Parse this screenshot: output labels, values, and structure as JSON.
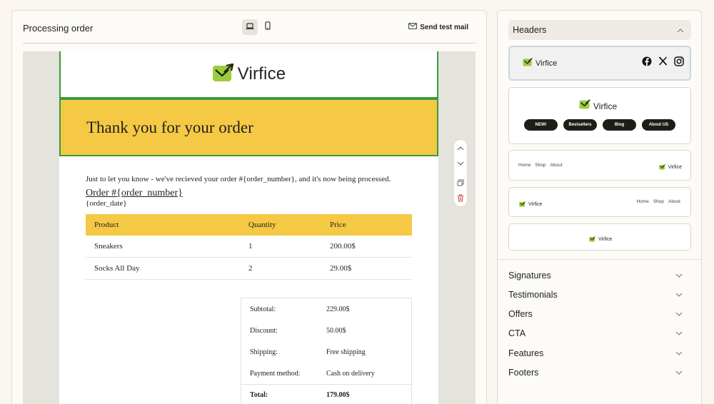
{
  "editor": {
    "title": "Processing order",
    "send_test_label": "Send test mail"
  },
  "email": {
    "brand": "Virfice",
    "hero_title": "Thank you for your order",
    "intro": "Just to let you know - we've recieved your order #{order_number}, and it's now being processed.",
    "order_link": "Order #{order_number}",
    "order_date": "{order_date}",
    "table": {
      "headers": [
        "Product",
        "Quantity",
        "Price"
      ],
      "rows": [
        [
          "Sneakers",
          "1",
          "200.00$"
        ],
        [
          "Socks All Day",
          "2",
          "29.00$"
        ]
      ]
    },
    "totals": [
      {
        "label": "Subtotal:",
        "value": "229.00$"
      },
      {
        "label": "Discount:",
        "value": "50.00$"
      },
      {
        "label": "Shipping:",
        "value": "Free shipping"
      },
      {
        "label": "Payment method:",
        "value": "Cash on delivery"
      },
      {
        "label": "Total:",
        "value": "179.00$"
      }
    ]
  },
  "library": {
    "open_section": "Headers",
    "templates": {
      "brand": "Virfice",
      "pills": [
        "NEW!",
        "Bestsellers",
        "Blog",
        "About US"
      ],
      "nav": [
        "Home",
        "Shop",
        "About"
      ]
    },
    "sections": [
      "Signatures",
      "Testimonials",
      "Offers",
      "CTA",
      "Features",
      "Footers"
    ]
  },
  "colors": {
    "accent_yellow": "#f6c945",
    "selection_green": "#3a9a3a",
    "logo_green": "#9ccc3c",
    "delete_red": "#d9453b"
  }
}
